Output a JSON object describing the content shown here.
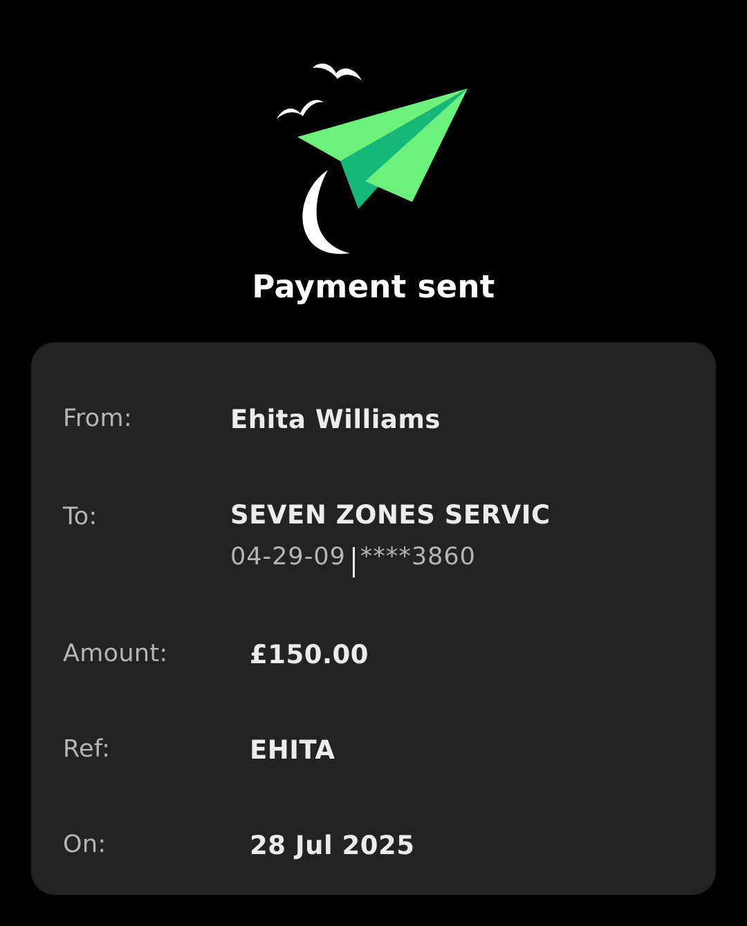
{
  "header": {
    "illustration_icon": "paper-plane-with-birds-icon",
    "title": "Payment sent"
  },
  "details": {
    "from": {
      "label": "From:",
      "value": "Ehita Williams"
    },
    "to": {
      "label": "To:",
      "value": "SEVEN ZONES SERVIC",
      "sort_code": "04-29-09",
      "account_number": "****3860"
    },
    "amount": {
      "label": "Amount:",
      "value": "£150.00"
    },
    "ref": {
      "label": "Ref:",
      "value": "EHITA"
    },
    "on": {
      "label": "On:",
      "value": "28 Jul 2025"
    }
  },
  "colors": {
    "background": "#000000",
    "card": "#232323",
    "plane_light": "#6cf27c",
    "plane_dark": "#16b77a",
    "label": "#b5b5b5",
    "value": "#ececec"
  }
}
